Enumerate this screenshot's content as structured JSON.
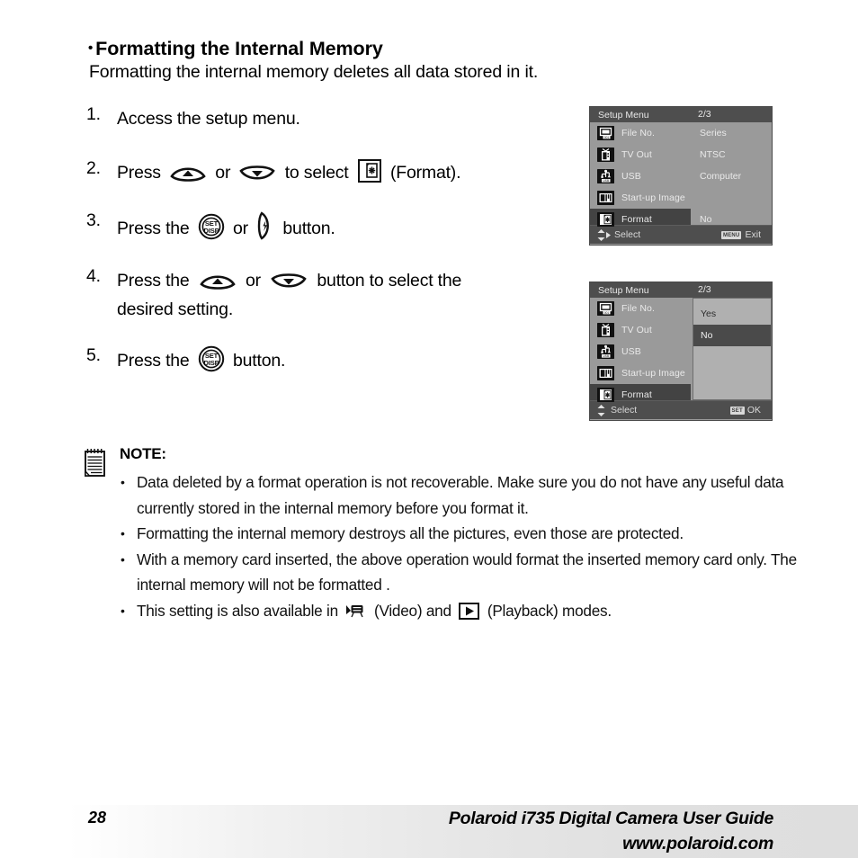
{
  "heading": {
    "bullet": "•",
    "title": "Formatting the Internal Memory",
    "subtitle": "Formatting the internal memory deletes all data stored in it."
  },
  "steps": [
    {
      "num": "1.",
      "text_before": "Access the setup menu.",
      "text_mid": "",
      "text_after": ""
    },
    {
      "num": "2.",
      "text_before": "Press",
      "text_or": "or",
      "text_mid": "to select",
      "text_after": "(Format)."
    },
    {
      "num": "3.",
      "text_before": "Press the",
      "text_or": "or",
      "text_after": "button."
    },
    {
      "num": "4.",
      "text_before": "Press the",
      "text_or": "or",
      "text_after": "button to select the",
      "text_line2": "desired setting."
    },
    {
      "num": "5.",
      "text_before": "Press the",
      "text_after": "button."
    }
  ],
  "icons": {
    "up_rocker": "up-rocker-button-icon",
    "down_rocker": "down-rocker-button-icon",
    "set_disp": "set-disp-button-icon",
    "set_disp_top": "SET",
    "set_disp_bottom": "DISP",
    "flash_right": "flash-right-button-icon",
    "format": "format-icon",
    "note": "note-pad-icon",
    "video": "video-mode-icon",
    "playback": "playback-mode-icon"
  },
  "lcd1": {
    "title": "Setup Menu",
    "page": "2/3",
    "rows": [
      {
        "icon": "file-no-icon",
        "label": "File No.",
        "value": "Series",
        "highlighted": false
      },
      {
        "icon": "tv-out-icon",
        "label": "TV Out",
        "value": "NTSC",
        "highlighted": false
      },
      {
        "icon": "usb-icon",
        "label": "USB",
        "value": "Computer",
        "highlighted": false
      },
      {
        "icon": "start-up-image-icon",
        "label": "Start-up Image",
        "value": "",
        "highlighted": false
      },
      {
        "icon": "format-menu-icon",
        "label": "Format",
        "value": "No",
        "highlighted": true
      }
    ],
    "bottom_left": "Select",
    "bottom_badge": "MENU",
    "bottom_right": "Exit"
  },
  "lcd2": {
    "title": "Setup Menu",
    "page": "2/3",
    "rows": [
      {
        "icon": "file-no-icon",
        "label": "File No.",
        "value": "",
        "highlighted": false
      },
      {
        "icon": "tv-out-icon",
        "label": "TV Out",
        "value": "",
        "highlighted": false
      },
      {
        "icon": "usb-icon",
        "label": "USB",
        "value": "",
        "highlighted": false
      },
      {
        "icon": "start-up-image-icon",
        "label": "Start-up Image",
        "value": "",
        "highlighted": false
      },
      {
        "icon": "format-menu-icon",
        "label": "Format",
        "value": "",
        "highlighted": true
      }
    ],
    "submenu": [
      {
        "label": "Yes",
        "selected": false
      },
      {
        "label": "No",
        "selected": true
      }
    ],
    "bottom_left": "Select",
    "bottom_badge": "SET",
    "bottom_right": "OK"
  },
  "note": {
    "title": "NOTE:",
    "bullet": "•",
    "items": [
      "Data deleted by a format operation is not recoverable. Make sure you do not have any useful data currently stored in the internal memory before you format it.",
      "Formatting the internal memory destroys all the pictures, even those are protected.",
      "With a memory card inserted, the above operation would format the inserted memory card only. The internal memory will not be formatted .",
      "This setting is also available in"
    ],
    "last_item_mid": "(Video) and",
    "last_item_end": "(Playback) modes."
  },
  "footer": {
    "page_number": "28",
    "line1": "Polaroid i735 Digital Camera User Guide",
    "line2": "www.polaroid.com"
  },
  "colors": {
    "lcd_bg": "#9a9a9a",
    "lcd_title_bg": "#4e4e4e",
    "lcd_highlight": "#434343",
    "submenu_bg": "#b0b0b0",
    "submenu_sel": "#4a4a4a"
  }
}
